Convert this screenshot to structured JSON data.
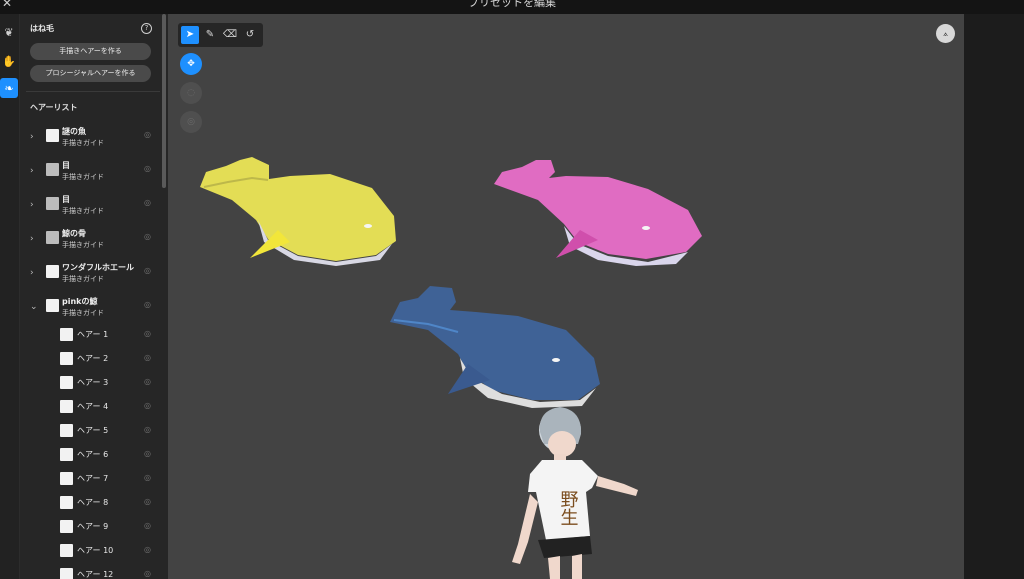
{
  "window": {
    "title": "プリセットを編集",
    "close_glyph": "✕"
  },
  "rail": {
    "icons": [
      "hair-icon",
      "hand-icon",
      "brush-icon"
    ]
  },
  "panel": {
    "title": "はね毛",
    "help_glyph": "?",
    "buttons": {
      "hand_drawn": "手描きヘアーを作る",
      "procedural": "プロシージャルヘアーを作る"
    },
    "list_title": "ヘアーリスト",
    "items": [
      {
        "name": "謎の魚",
        "type": "手描きガイド"
      },
      {
        "name": "目",
        "type": "手描きガイド"
      },
      {
        "name": "目",
        "type": "手描きガイド"
      },
      {
        "name": "鯨の骨",
        "type": "手描きガイド"
      },
      {
        "name": "ワンダフルホエール",
        "type": "手描きガイド"
      },
      {
        "name": "pinkの鯨",
        "type": "手描きガイド"
      }
    ],
    "hairs": [
      "ヘアー 1",
      "ヘアー 2",
      "ヘアー 3",
      "ヘアー 4",
      "ヘアー 5",
      "ヘアー 6",
      "ヘアー 7",
      "ヘアー 8",
      "ヘアー 9",
      "ヘアー 10",
      "ヘアー 12"
    ]
  },
  "viewport": {
    "tools": [
      "select-tool",
      "pen-tool",
      "eraser-tool",
      "hook-tool"
    ],
    "shirt_text": "野生",
    "colors": {
      "yellow_whale": "#e3dd55",
      "pink_whale": "#e06cc2",
      "blue_whale": "#3f6296",
      "accent": "#1e90ff"
    }
  }
}
